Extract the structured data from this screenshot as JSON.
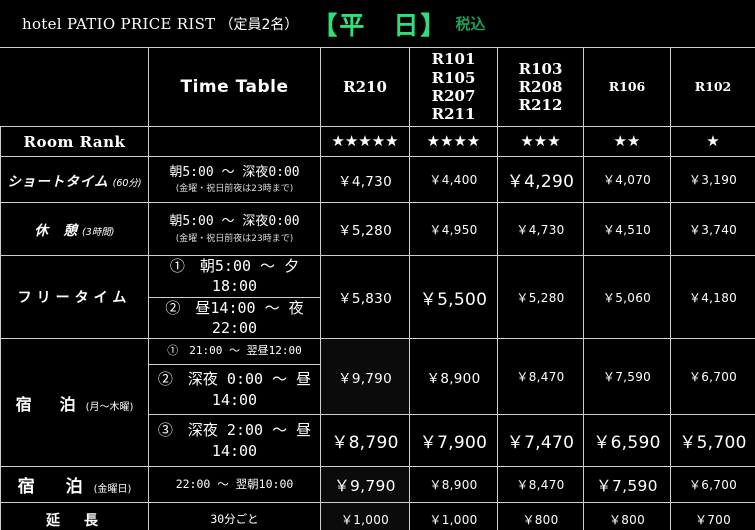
{
  "header": {
    "brand": "hotel PATIO  PRICE RIST",
    "occupancy": "（定員2名）",
    "weekday_badge": "【平　日】",
    "tax_note": "税込",
    "colors": {
      "green_accent": "#2ee07a",
      "green_band": "#1c9e53",
      "tax_green": "#1f9e55"
    }
  },
  "table": {
    "time_table_header": "Time Table",
    "room_columns": [
      {
        "label": "R210",
        "rooms": [
          "R210"
        ],
        "stars": "★★★★★",
        "star_count": 5
      },
      {
        "label": "R101\nR105\nR207\nR211",
        "rooms": [
          "R101",
          "R105",
          "R207",
          "R211"
        ],
        "stars": "★★★★",
        "star_count": 4
      },
      {
        "label": "R103\nR208\nR212",
        "rooms": [
          "R103",
          "R208",
          "R212"
        ],
        "stars": "★★★",
        "star_count": 3
      },
      {
        "label": "R106",
        "rooms": [
          "R106"
        ],
        "stars": "★★",
        "star_count": 2
      },
      {
        "label": "R102",
        "rooms": [
          "R102"
        ],
        "stars": "★",
        "star_count": 1
      }
    ],
    "rank_row_label": "Room Rank",
    "rows": [
      {
        "key": "short_time",
        "label_main": "ショートタイム",
        "label_sub": "(60分)",
        "time": "朝5:00 ～ 深夜0:00",
        "time_note": "(金曜・祝日前夜は23時まで)",
        "prices": [
          "￥4,730",
          "￥4,400",
          "￥4,290",
          "￥4,070",
          "￥3,190"
        ]
      },
      {
        "key": "rest",
        "label_main": "休　憩",
        "label_sub": "(3時間)",
        "time": "朝5:00 ～ 深夜0:00",
        "time_note": "(金曜・祝日前夜は23時まで)",
        "prices": [
          "￥5,280",
          "￥4,950",
          "￥4,730",
          "￥4,510",
          "￥3,740"
        ]
      },
      {
        "key": "free_time",
        "label_main": "フリータイム",
        "label_sub": "",
        "sub_rows": [
          {
            "time": "①　朝5:00 ～ 夕18:00"
          },
          {
            "time": "②　昼14:00 ～ 夜22:00"
          }
        ],
        "prices": [
          "￥5,830",
          "￥5,500",
          "￥5,280",
          "￥5,060",
          "￥4,180"
        ]
      },
      {
        "key": "stay_mon_thu",
        "label_main": "宿　泊",
        "label_sub": "(月～木曜)",
        "sub_rows": [
          {
            "time": "①　21:00 ～ 翌昼12:00"
          },
          {
            "time": "②　深夜 0:00 ～ 昼14:00"
          },
          {
            "time": "③　深夜 2:00 ～ 昼14:00"
          }
        ],
        "prices_12": [
          "￥9,790",
          "￥8,900",
          "￥8,470",
          "￥7,590",
          "￥6,700"
        ],
        "prices_3": [
          "￥8,790",
          "￥7,900",
          "￥7,470",
          "￥6,590",
          "￥5,700"
        ]
      },
      {
        "key": "stay_friday",
        "label_main": "宿　泊",
        "label_sub": "(金曜日)",
        "time": "22:00 ～ 翌朝10:00",
        "prices": [
          "￥9,790",
          "￥8,900",
          "￥8,470",
          "￥7,590",
          "￥6,700"
        ]
      },
      {
        "key": "extension",
        "label_main": "延　長",
        "label_sub": "",
        "time": "30分ごと",
        "prices": [
          "￥1,000",
          "￥1,000",
          "￥800",
          "￥800",
          "￥700"
        ]
      }
    ]
  }
}
